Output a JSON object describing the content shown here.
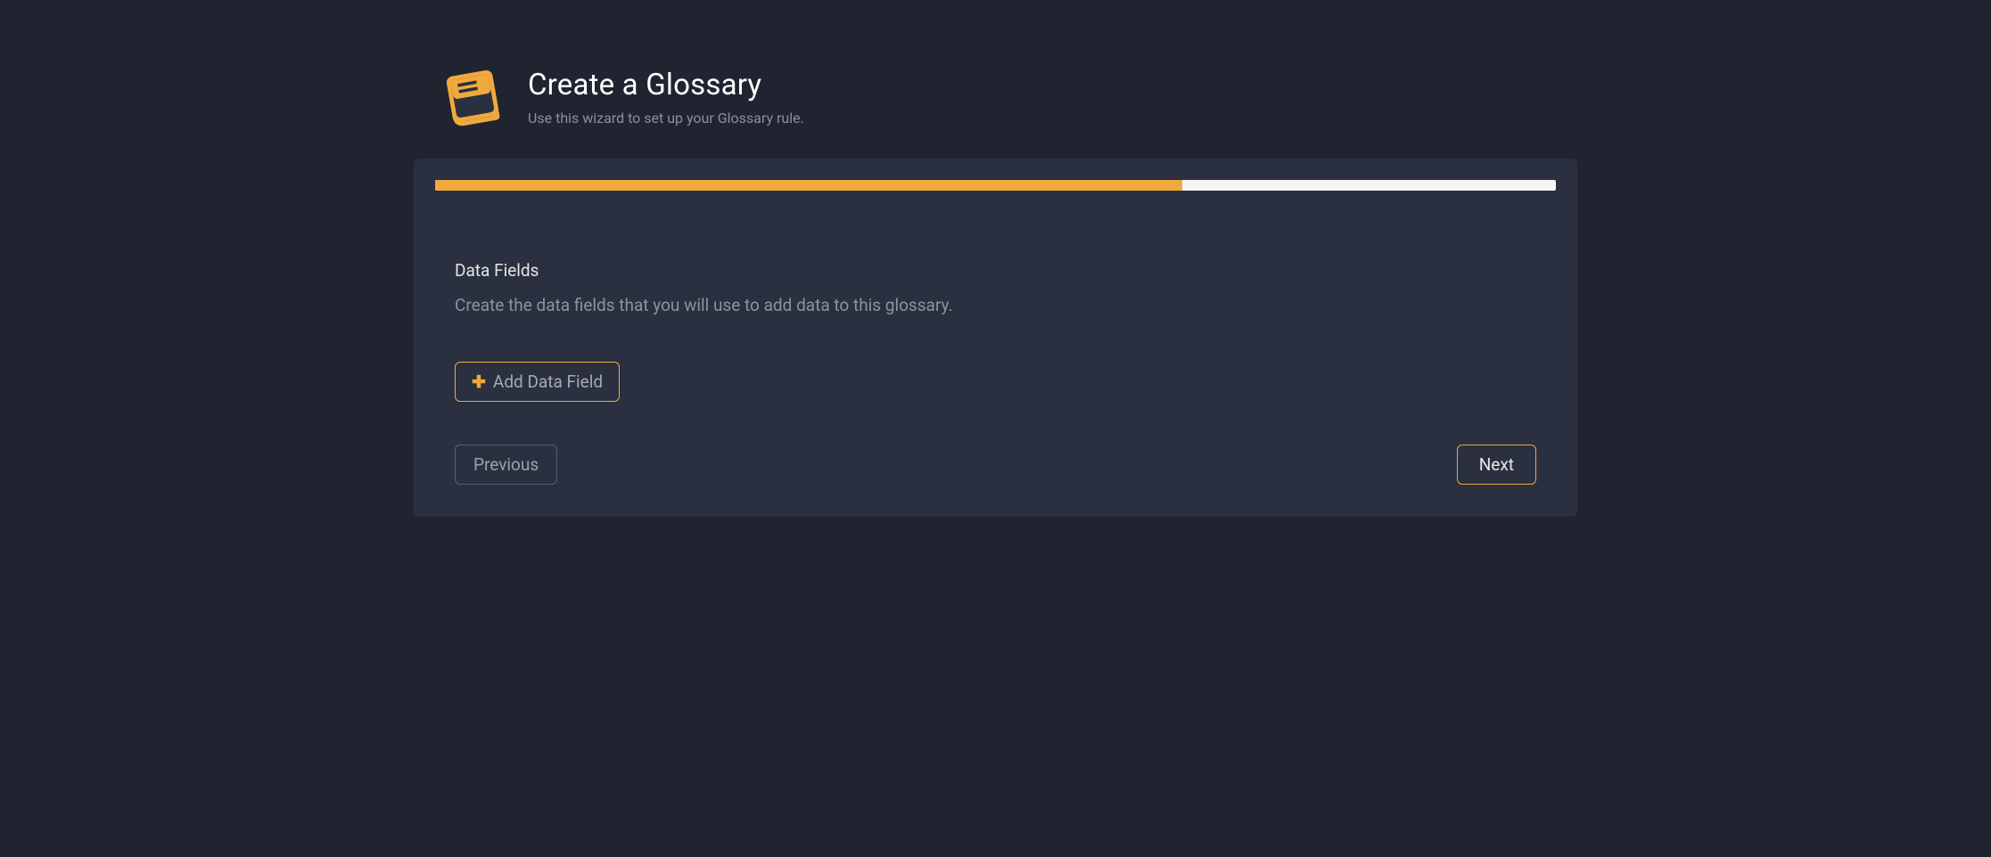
{
  "header": {
    "title": "Create a Glossary",
    "subtitle": "Use this wizard to set up your Glossary rule."
  },
  "progress": {
    "percent": 66.7
  },
  "section": {
    "title": "Data Fields",
    "description": "Create the data fields that you will use to add data to this glossary.",
    "addButtonLabel": "Add Data Field"
  },
  "nav": {
    "previousLabel": "Previous",
    "nextLabel": "Next"
  },
  "colors": {
    "accent": "#f0a93d",
    "background": "#1f2430",
    "card": "#2a303f"
  }
}
